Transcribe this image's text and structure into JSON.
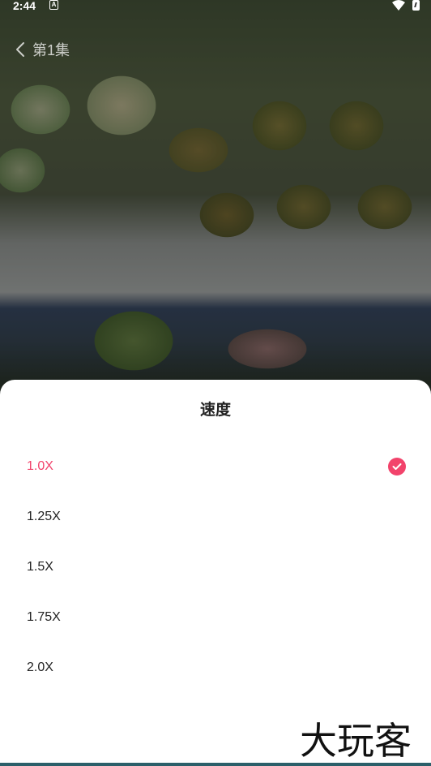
{
  "status_bar": {
    "time": "2:44",
    "notification_letter": "A",
    "icons": [
      "wifi-icon",
      "battery-icon"
    ]
  },
  "header": {
    "back_icon": "chevron-left-icon",
    "episode_title": "第1集"
  },
  "speed_sheet": {
    "title": "速度",
    "options": [
      {
        "label": "1.0X",
        "selected": true
      },
      {
        "label": "1.25X",
        "selected": false
      },
      {
        "label": "1.5X",
        "selected": false
      },
      {
        "label": "1.75X",
        "selected": false
      },
      {
        "label": "2.0X",
        "selected": false
      }
    ],
    "selected_icon": "check-circle-icon"
  },
  "watermark": {
    "text": "大玩客"
  },
  "colors": {
    "accent": "#f2436b",
    "sheet_background": "#ffffff",
    "text_primary": "#222222"
  }
}
